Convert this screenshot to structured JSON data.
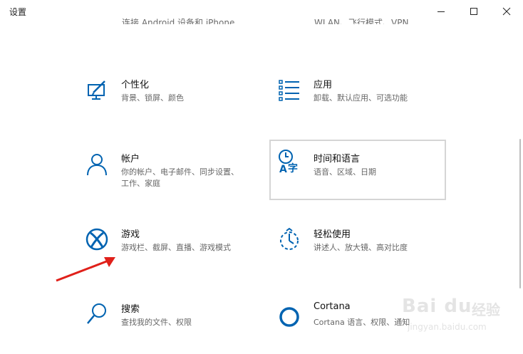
{
  "window": {
    "title": "设置"
  },
  "cut_off_row": {
    "left": "连接 Android 设备和 iPhone",
    "right": "WLAN、飞行模式、VPN"
  },
  "tiles": [
    {
      "id": "personalization",
      "title": "个性化",
      "desc": "背景、锁屏、颜色",
      "icon": "personalization-icon"
    },
    {
      "id": "apps",
      "title": "应用",
      "desc": "卸载、默认应用、可选功能",
      "icon": "apps-list-icon"
    },
    {
      "id": "accounts",
      "title": "帐户",
      "desc": "你的帐户、电子邮件、同步设置、工作、家庭",
      "icon": "person-icon"
    },
    {
      "id": "time-language",
      "title": "时间和语言",
      "desc": "语音、区域、日期",
      "icon": "time-language-icon"
    },
    {
      "id": "gaming",
      "title": "游戏",
      "desc": "游戏栏、截屏、直播、游戏模式",
      "icon": "xbox-icon"
    },
    {
      "id": "ease-of-access",
      "title": "轻松使用",
      "desc": "讲述人、放大镜、高对比度",
      "icon": "ease-of-access-icon"
    },
    {
      "id": "search",
      "title": "搜索",
      "desc": "查找我的文件、权限",
      "icon": "search-icon"
    },
    {
      "id": "cortana",
      "title": "Cortana",
      "desc": "Cortana 语言、权限、通知",
      "icon": "cortana-icon"
    }
  ],
  "colors": {
    "accent": "#0063b1",
    "annotation_arrow": "#e0201a"
  },
  "watermark": {
    "brand": "Bai du",
    "word": "经验",
    "url": "jingyan.baidu.com"
  }
}
